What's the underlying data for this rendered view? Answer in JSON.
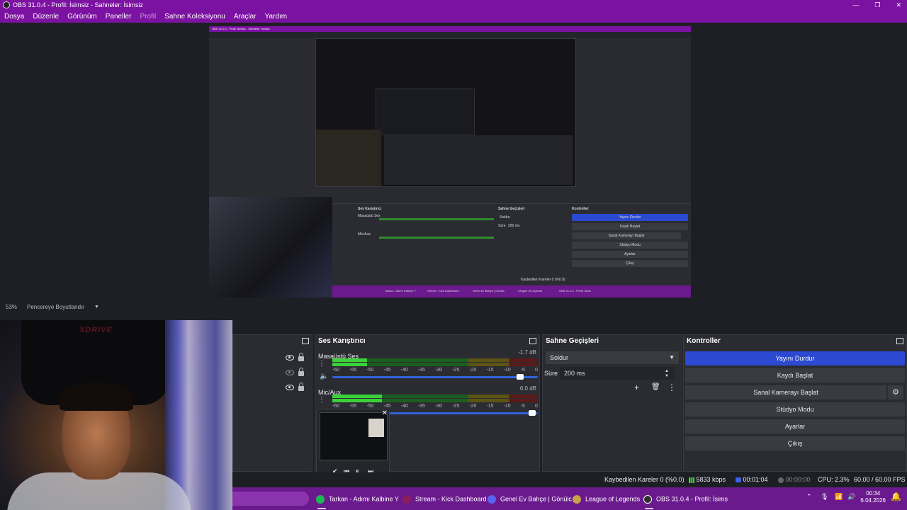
{
  "window": {
    "title": "OBS 31.0.4 - Profil: İsimsiz - Sahneler: İsimsiz",
    "controls": [
      "—",
      "❐",
      "✕"
    ]
  },
  "menu": [
    "Dosya",
    "Düzenle",
    "Görünüm",
    "Paneller",
    "Profil",
    "Sahne Koleksiyonu",
    "Araçlar",
    "Yardım"
  ],
  "preview": {
    "zoom": "53%",
    "scale_mode": "Pencereye Boyutlandır",
    "nested": {
      "title": "OBS 31.0.4 - Profil: İsimsiz - Sahneler: İsimsiz",
      "mixer_title": "Ses Karıştırıcı",
      "transitions_title": "Sahne Geçişleri",
      "controls_title": "Kontroller",
      "channel1": "Masaüstü Ses",
      "channel2": "Mic/Aux",
      "transition": "Soldur",
      "duration_label": "Süre",
      "duration": "200 ms",
      "buttons": [
        "Yayını Durdur",
        "Kaydı Başlat",
        "Sanal Kamerayı Başlat",
        "Stüdyo Modu",
        "Ayarlar",
        "Çıkış"
      ],
      "status": "Kaybedilen Kareler 0 (%0.0)",
      "taskbar": [
        "Tarkan - Adımı Kalbine Y",
        "Stream - Kick Dashboard",
        "Genel Ev Bahçe | Gönülc",
        "League of Legends",
        "OBS 31.0.4 - Profil: İsims"
      ]
    }
  },
  "mixer": {
    "title": "Ses Karıştırıcı",
    "ticks": [
      "-60",
      "-55",
      "-50",
      "-45",
      "-40",
      "-35",
      "-30",
      "-25",
      "-20",
      "-15",
      "-10",
      "-5",
      "0"
    ],
    "channels": [
      {
        "name": "Masaüstü Ses",
        "db": "-1.7 dB",
        "level": 0.17,
        "volume": 0.93
      },
      {
        "name": "Mic/Aux",
        "db": "6.0 dB",
        "level": 0.24,
        "volume": 0.99
      }
    ]
  },
  "transitions": {
    "title": "Sahne Geçişleri",
    "selected": "Soldur",
    "duration_label": "Süre",
    "duration": "200 ms"
  },
  "controls": {
    "title": "Kontroller",
    "stop_stream": "Yayını Durdur",
    "start_record": "Kaydı Başlat",
    "start_virtualcam": "Sanal Kamerayı Başlat",
    "studio_mode": "Stüdyo Modu",
    "settings": "Ayarlar",
    "exit": "Çıkış"
  },
  "status": {
    "dropped": "Kaybedilen Kareler 0 (%0.0)",
    "bitrate": "5833 kbps",
    "stream_time": "00:01:04",
    "rec_time": "00:00:00",
    "cpu": "CPU: 2.3%",
    "fps": "60.00 / 60.00 FPS"
  },
  "taskbar": {
    "items": [
      {
        "label": "Tarkan - Adımı Kalbine Y",
        "color": "#1db954"
      },
      {
        "label": "Stream - Kick Dashboard",
        "color": "#8a1f5c"
      },
      {
        "label": "Genel Ev Bahçe | Gönülc",
        "color": "#5865f2"
      },
      {
        "label": "League of Legends",
        "color": "#c8a24a"
      },
      {
        "label": "OBS 31.0.4 - Profil: İsims",
        "color": "#302e31"
      }
    ],
    "time": "00:34",
    "date": "6.04.2026"
  },
  "webcam": {
    "chair_brand": "XDRIVE"
  },
  "colors": {
    "accent": "#7b12a1",
    "primary_button": "#2c4ad1",
    "panel": "#2b2c32"
  }
}
